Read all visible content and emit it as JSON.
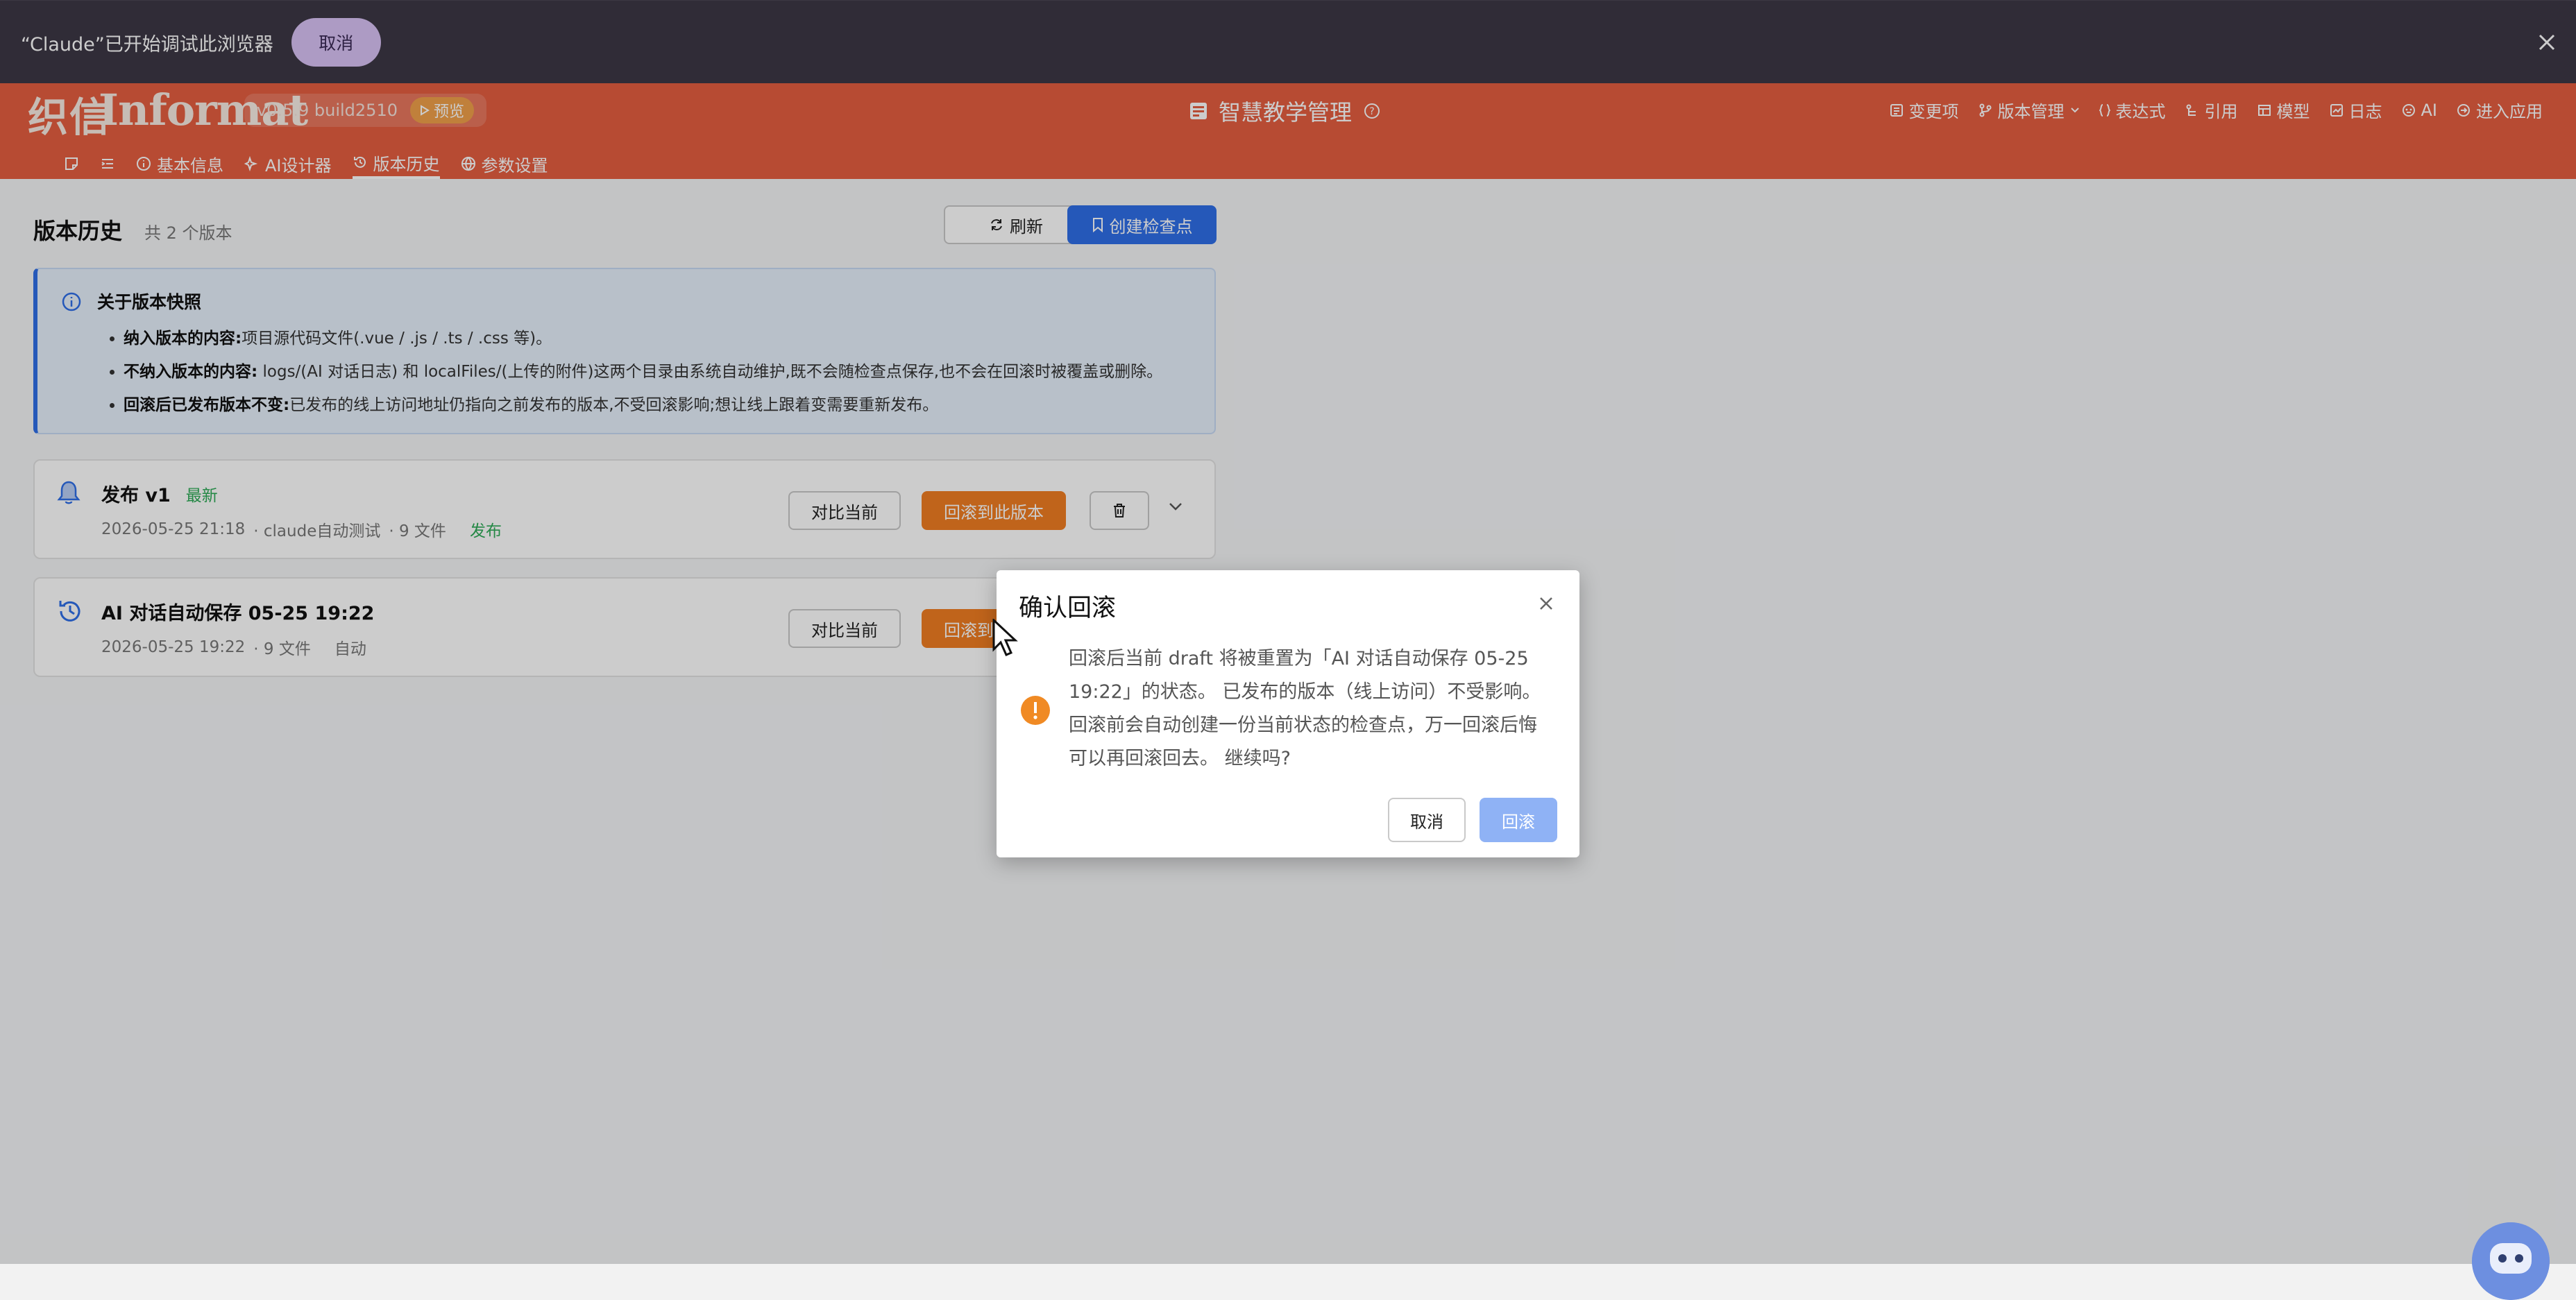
{
  "debug_bar": {
    "message": "“Claude”已开始调试此浏览器",
    "cancel_label": "取消"
  },
  "header": {
    "logo_mark": "织信",
    "logo_word": "Informat",
    "version": "v0.5.9 build2510",
    "preview_label": "预览",
    "app_title": "智慧教学管理",
    "toolbar": [
      "变更项",
      "版本管理",
      "表达式",
      "引用",
      "模型",
      "日志",
      "AI",
      "进入应用"
    ]
  },
  "tabs": {
    "items": [
      "基本信息",
      "AI设计器",
      "版本历史",
      "参数设置"
    ],
    "active": "版本历史"
  },
  "page": {
    "title": "版本历史",
    "count": "共 2 个版本",
    "refresh_label": "刷新",
    "checkpoint_label": "创建检查点"
  },
  "info": {
    "title": "关于版本快照",
    "items": [
      {
        "label": "纳入版本的内容:",
        "text": "项目源代码文件(.vue / .js / .ts / .css 等)。"
      },
      {
        "label": "不纳入版本的内容:",
        "text": " logs/(AI 对话日志) 和 localFiles/(上传的附件)这两个目录由系统自动维护,既不会随检查点保存,也不会在回滚时被覆盖或删除。"
      },
      {
        "label": "回滚后已发布版本不变:",
        "text": "已发布的线上访问地址仍指向之前发布的版本,不受回滚影响;想让线上跟着变需要重新发布。"
      }
    ]
  },
  "versions": [
    {
      "name": "发布 v1",
      "badge": "最新",
      "time": "2026-05-25 21:18",
      "author": "· claude自动测试",
      "files": "· 9 文件",
      "tag": "发布",
      "compare_label": "对比当前",
      "rollback_label": "回滚到此版本"
    },
    {
      "name": "AI 对话自动保存 05-25 19:22",
      "time": "2026-05-25 19:22",
      "files": "· 9 文件",
      "tag": "自动",
      "compare_label": "对比当前",
      "rollback_label": "回滚到此版本"
    }
  ],
  "modal": {
    "title": "确认回滚",
    "body": "回滚后当前 draft 将被重置为「AI 对话自动保存 05-25 19:22」的状态。 已发布的版本（线上访问）不受影响。 回滚前会自动创建一份当前状态的检查点，万一回滚后悔可以再回滚回去。 继续吗?",
    "cancel_label": "取消",
    "ok_label": "回滚"
  },
  "colors": {
    "header": "#e55e40",
    "primary": "#2f6fe8",
    "rollback": "#f07d22",
    "success": "#2eaa57",
    "warning": "#f08a24"
  }
}
